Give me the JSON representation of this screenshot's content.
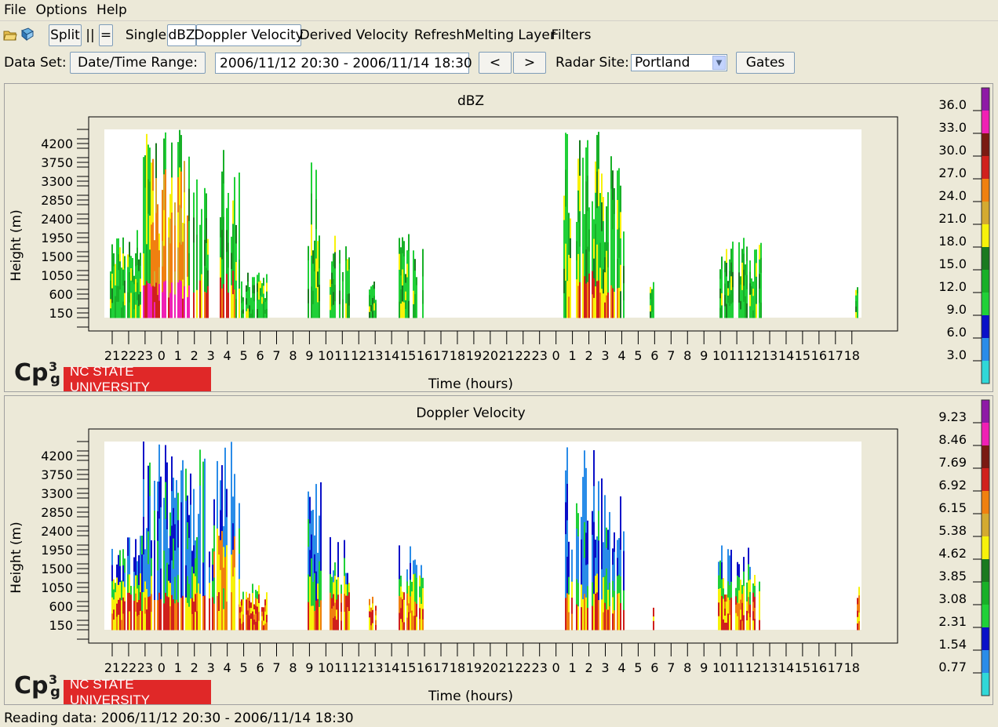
{
  "menu": {
    "items": [
      "File",
      "Options",
      "Help"
    ]
  },
  "toolbar": {
    "split": "Split",
    "pause": "||",
    "equal": "=",
    "single": "Single",
    "dbz": "dBZ",
    "doppler": "Doppler Velocity",
    "derived": "Derived Velocity",
    "refresh": "Refresh",
    "melting": "Melting Layer",
    "filters": "Filters"
  },
  "dataset": {
    "label": "Data Set:",
    "date_button": "Date/Time Range:",
    "range_value": "2006/11/12 20:30 - 2006/11/14 18:30",
    "prev": "<",
    "next": ">",
    "site_label": "Radar Site:",
    "site_value": "Portland",
    "gates": "Gates"
  },
  "logo": {
    "text": "NC STATE UNIVERSITY"
  },
  "status": "Reading data: 2006/11/12 20:30 - 2006/11/14 18:30",
  "chart_data": [
    {
      "type": "heatmap",
      "title": "dBZ",
      "xlabel": "Time (hours)",
      "ylabel": "Height (m)",
      "x_ticks": [
        "21",
        "22",
        "23",
        "0",
        "1",
        "2",
        "3",
        "4",
        "5",
        "6",
        "7",
        "8",
        "9",
        "10",
        "11",
        "12",
        "13",
        "14",
        "15",
        "16",
        "17",
        "18",
        "19",
        "20",
        "21",
        "22",
        "23",
        "0",
        "1",
        "2",
        "3",
        "4",
        "5",
        "6",
        "7",
        "8",
        "9",
        "10",
        "11",
        "12",
        "13",
        "14",
        "15",
        "16",
        "17",
        "18"
      ],
      "y_ticks": [
        "4200",
        "3750",
        "3300",
        "2850",
        "2400",
        "1950",
        "1500",
        "1050",
        "600",
        "150"
      ],
      "colorbar_labels": [
        "36.0",
        "33.0",
        "30.0",
        "27.0",
        "24.0",
        "21.0",
        "18.0",
        "15.0",
        "12.0",
        "9.0",
        "6.0",
        "3.0"
      ],
      "colorbar_colors": [
        "#8e1aa6",
        "#f020b4",
        "#7a1a12",
        "#d0201c",
        "#f08010",
        "#d4aa30",
        "#f7f20a",
        "#1a7a20",
        "#18b028",
        "#20d038",
        "#0a10c8",
        "#2a8ce8",
        "#30d8d8"
      ]
    },
    {
      "type": "heatmap",
      "title": "Doppler Velocity",
      "xlabel": "Time (hours)",
      "ylabel": "Height (m)",
      "x_ticks": [
        "21",
        "22",
        "23",
        "0",
        "1",
        "2",
        "3",
        "4",
        "5",
        "6",
        "7",
        "8",
        "9",
        "10",
        "11",
        "12",
        "13",
        "14",
        "15",
        "16",
        "17",
        "18",
        "19",
        "20",
        "21",
        "22",
        "23",
        "0",
        "1",
        "2",
        "3",
        "4",
        "5",
        "6",
        "7",
        "8",
        "9",
        "10",
        "11",
        "12",
        "13",
        "14",
        "15",
        "16",
        "17",
        "18"
      ],
      "y_ticks": [
        "4200",
        "3750",
        "3300",
        "2850",
        "2400",
        "1950",
        "1500",
        "1050",
        "600",
        "150"
      ],
      "colorbar_labels": [
        "9.23",
        "8.46",
        "7.69",
        "6.92",
        "6.15",
        "5.38",
        "4.62",
        "3.85",
        "3.08",
        "2.31",
        "1.54",
        "0.77"
      ],
      "colorbar_colors": [
        "#8e1aa6",
        "#f020b4",
        "#7a1a12",
        "#d0201c",
        "#f08010",
        "#d4aa30",
        "#f7f20a",
        "#1a7a20",
        "#18b028",
        "#20d038",
        "#0a10c8",
        "#2a8ce8",
        "#30d8d8"
      ]
    }
  ]
}
